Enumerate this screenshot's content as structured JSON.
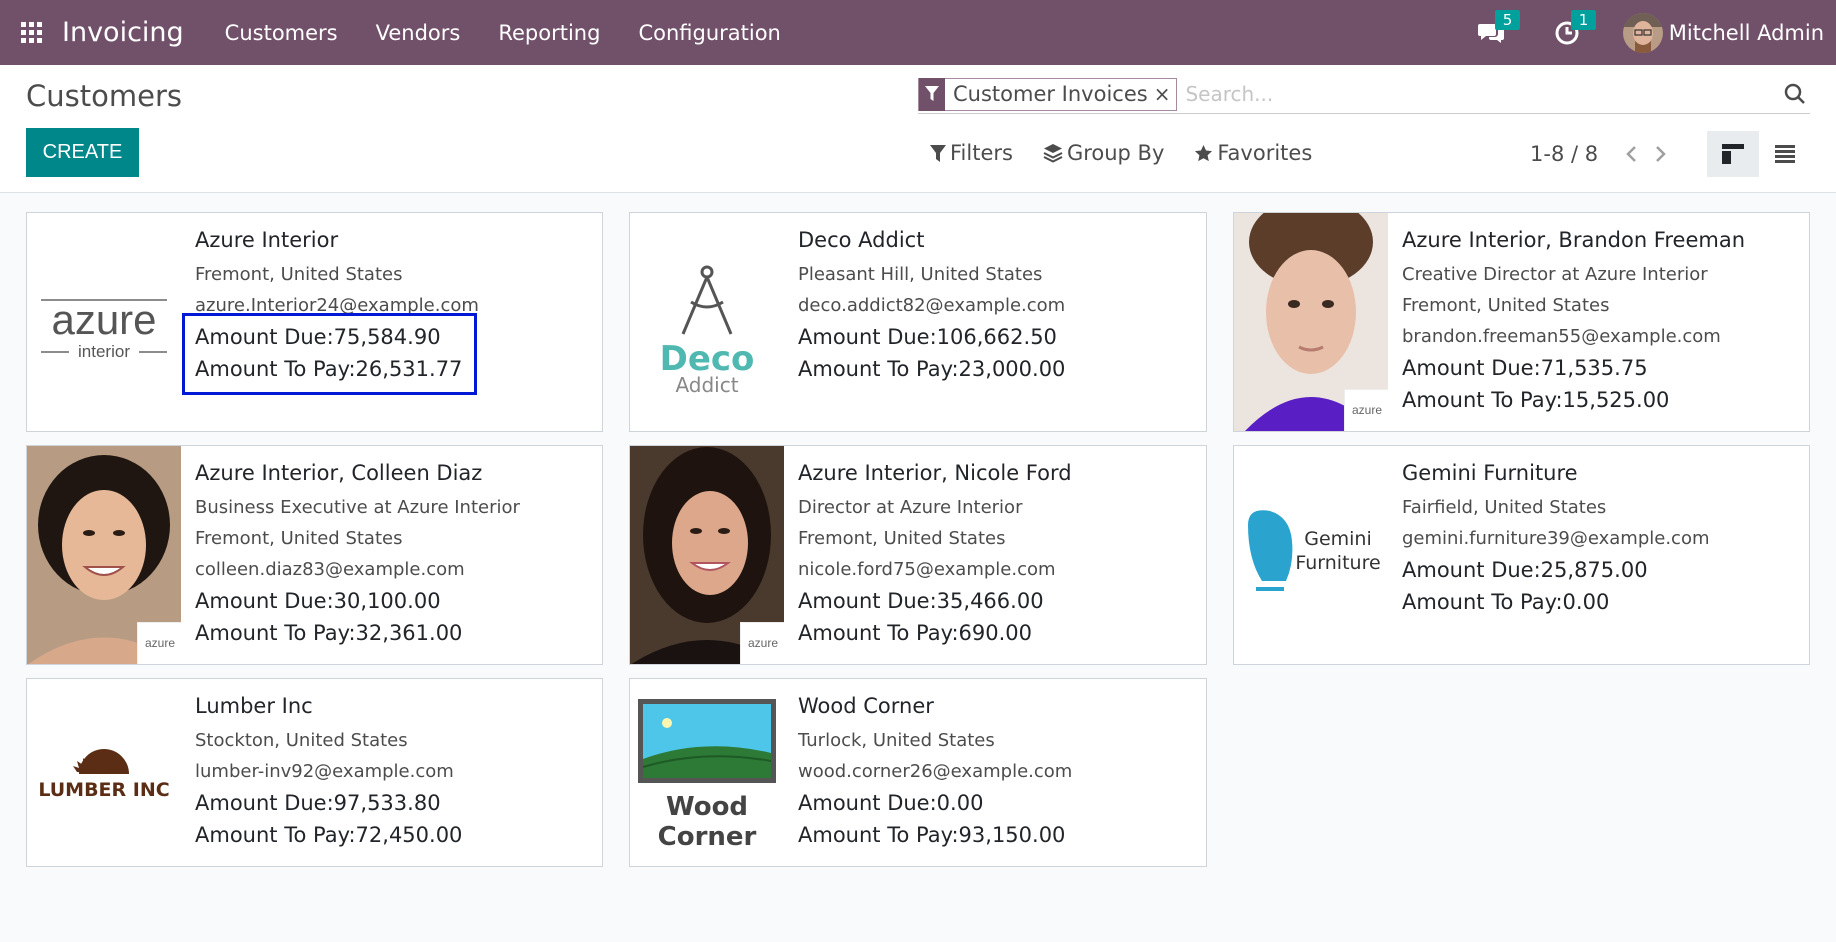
{
  "navbar": {
    "app_name": "Invoicing",
    "menu": [
      "Customers",
      "Vendors",
      "Reporting",
      "Configuration"
    ],
    "messages_count": "5",
    "activities_count": "1",
    "user_name": "Mitchell Admin"
  },
  "control": {
    "title": "Customers",
    "create_label": "CREATE",
    "facet_label": "Customer Invoices",
    "facet_remove": "×",
    "search_placeholder": "Search...",
    "filters_label": "Filters",
    "group_by_label": "Group By",
    "favorites_label": "Favorites",
    "pager": "1-8 / 8"
  },
  "cards": [
    {
      "name": "Azure Interior",
      "lines": [
        "Fremont, United States",
        "azure.Interior24@example.com"
      ],
      "amount_due": "Amount Due:75,584.90",
      "amount_to_pay": "Amount To Pay:26,531.77",
      "image": "azure-interior-logo"
    },
    {
      "name": "Deco Addict",
      "lines": [
        "Pleasant Hill, United States",
        "deco.addict82@example.com"
      ],
      "amount_due": "Amount Due:106,662.50",
      "amount_to_pay": "Amount To Pay:23,000.00",
      "image": "deco-addict-logo"
    },
    {
      "name": "Azure Interior, Brandon Freeman",
      "lines": [
        "Creative Director at Azure Interior",
        "Fremont, United States",
        "brandon.freeman55@example.com"
      ],
      "amount_due": "Amount Due:71,535.75",
      "amount_to_pay": "Amount To Pay:15,525.00",
      "image": "person-photo"
    },
    {
      "name": "Azure Interior, Colleen Diaz",
      "lines": [
        "Business Executive at Azure Interior",
        "Fremont, United States",
        "colleen.diaz83@example.com"
      ],
      "amount_due": "Amount Due:30,100.00",
      "amount_to_pay": "Amount To Pay:32,361.00",
      "image": "person-photo"
    },
    {
      "name": "Azure Interior, Nicole Ford",
      "lines": [
        "Director at Azure Interior",
        "Fremont, United States",
        "nicole.ford75@example.com"
      ],
      "amount_due": "Amount Due:35,466.00",
      "amount_to_pay": "Amount To Pay:690.00",
      "image": "person-photo"
    },
    {
      "name": "Gemini Furniture",
      "lines": [
        "Fairfield, United States",
        "gemini.furniture39@example.com"
      ],
      "amount_due": "Amount Due:25,875.00",
      "amount_to_pay": "Amount To Pay:0.00",
      "image": "gemini-furniture-logo"
    },
    {
      "name": "Lumber Inc",
      "lines": [
        "Stockton, United States",
        "lumber-inv92@example.com"
      ],
      "amount_due": "Amount Due:97,533.80",
      "amount_to_pay": "Amount To Pay:72,450.00",
      "image": "lumber-inc-logo"
    },
    {
      "name": "Wood Corner",
      "lines": [
        "Turlock, United States",
        "wood.corner26@example.com"
      ],
      "amount_due": "Amount Due:0.00",
      "amount_to_pay": "Amount To Pay:93,150.00",
      "image": "wood-corner-logo"
    }
  ],
  "logos": {
    "azure_main": "azure",
    "azure_sub": "interior",
    "deco_main": "Deco",
    "deco_sub": "Addict",
    "gemini_1": "Gemini",
    "gemini_2": "Furniture",
    "lumber": "LUMBER INC",
    "wood_1": "Wood",
    "wood_2": "Corner"
  },
  "colors": {
    "navbar": "#71506a",
    "accent": "#00878a",
    "badge": "#00a09d",
    "highlight": "#0019d4"
  }
}
